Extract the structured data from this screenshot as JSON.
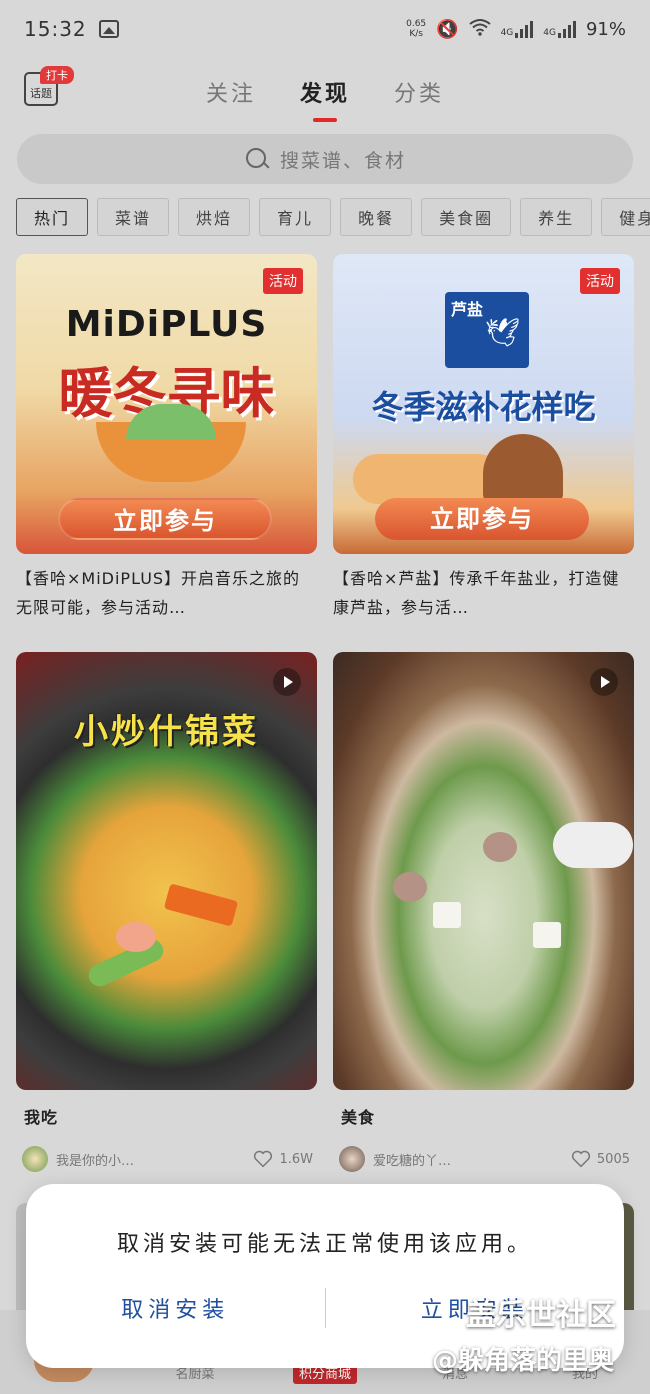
{
  "status_bar": {
    "time": "15:32",
    "net_speed_value": "0.65",
    "net_speed_unit": "K/s",
    "signal_1": "4G",
    "signal_2": "4G",
    "battery": "91%"
  },
  "top_nav": {
    "topic_badge": "打卡",
    "topic_label": "话题",
    "tabs": [
      "关注",
      "发现",
      "分类"
    ],
    "active_tab": "发现"
  },
  "search": {
    "placeholder": "搜菜谱、食材"
  },
  "categories": [
    "热门",
    "菜谱",
    "烘焙",
    "育儿",
    "晚餐",
    "美食圈",
    "养生",
    "健身"
  ],
  "cards": [
    {
      "badge": "活动",
      "brand": "MiDiPLUS",
      "headline": "暖冬寻味",
      "cta": "立即参与",
      "title": "【香哈×MiDiPLUS】开启音乐之旅的无限可能，参与活动…"
    },
    {
      "badge": "活动",
      "brand": "芦盐",
      "headline": "冬季滋补花样吃",
      "cta": "立即参与",
      "title": "【香哈×芦盐】传承千年盐业，打造健康芦盐，参与活…"
    },
    {
      "overlay_text": "小炒什锦菜",
      "title": "我吃",
      "author": "我是你的小…",
      "likes": "1.6W"
    },
    {
      "title": "美食",
      "author": "爱吃糖的丫…",
      "likes": "5005"
    }
  ],
  "bottom_nav": [
    "名厨菜",
    "积分商城",
    "消息",
    "我的"
  ],
  "dialog": {
    "message": "取消安装可能无法正常使用该应用。",
    "cancel": "取消安装",
    "confirm": "立即安装"
  },
  "watermark": {
    "line1": "盖乐世社区",
    "line2": "@躲角落的里奥"
  },
  "colors": {
    "accent": "#e02a2a",
    "dialog_button": "#1f4fa0",
    "dim_background": "#d8d8d8"
  }
}
